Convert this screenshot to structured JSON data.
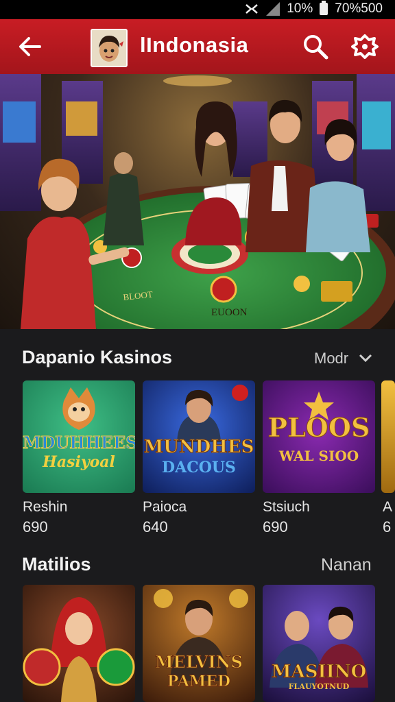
{
  "status": {
    "battery_text": "10%",
    "battery_percent": "70%500"
  },
  "appbar": {
    "title": "lIndonasia"
  },
  "section1": {
    "title": "Dapanio Kasinos",
    "more_label": "Modr",
    "cards": [
      {
        "name": "Reshin",
        "value": "690",
        "logo_line1": "MDUHHEES",
        "logo_line2": "Hasiyoal"
      },
      {
        "name": "Paioca",
        "value": "640",
        "logo_line1": "MUNDHES",
        "logo_line2": "DACOUS"
      },
      {
        "name": "Stsiuch",
        "value": "690",
        "logo_line1": "PLOOS",
        "logo_line2": "WAL SIOO"
      },
      {
        "name": "A",
        "value": "6"
      }
    ]
  },
  "section2": {
    "title": "Matilios",
    "more_label": "Nanan",
    "cards": [
      {
        "logo_line1": ""
      },
      {
        "logo_line1": "MELVINS",
        "logo_line2": "PAMED"
      },
      {
        "logo_line1": "MASIINO",
        "logo_line2": "FLAUYOTNUD"
      }
    ]
  },
  "hero": {
    "table_text": "EUOON",
    "table_text2": "BLOOT"
  },
  "colors": {
    "appbar": "#c81d24",
    "background": "#1b1b1d"
  }
}
